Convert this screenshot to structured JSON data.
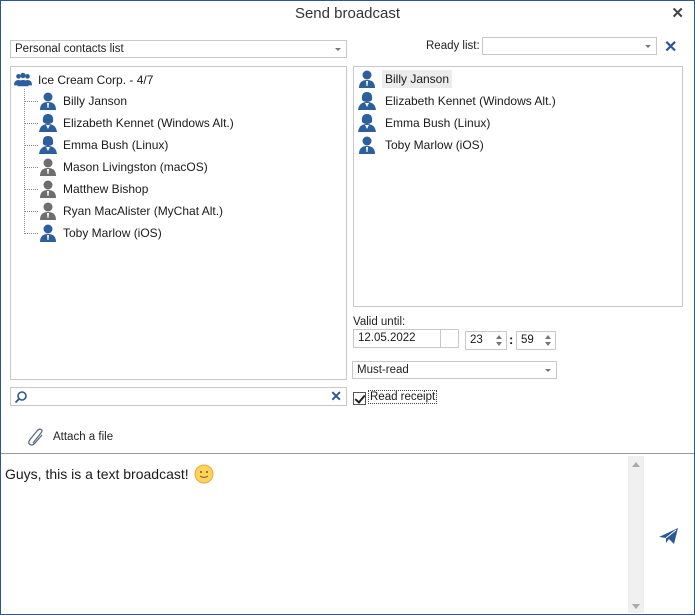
{
  "window": {
    "title": "Send broadcast",
    "close_icon": "close-icon"
  },
  "contacts": {
    "source_selected": "Personal contacts list",
    "group": {
      "label": "Ice Cream Corp. - 4/7",
      "icon": "group-icon",
      "members": [
        {
          "name": "Billy Janson",
          "gender": "male",
          "status": "online"
        },
        {
          "name": "Elizabeth Kennet (Windows Alt.)",
          "gender": "female",
          "status": "online"
        },
        {
          "name": "Emma Bush (Linux)",
          "gender": "female",
          "status": "online"
        },
        {
          "name": "Mason Livingston (macOS)",
          "gender": "male",
          "status": "offline"
        },
        {
          "name": "Matthew Bishop",
          "gender": "male",
          "status": "offline"
        },
        {
          "name": "Ryan MacAlister (MyChat Alt.)",
          "gender": "male",
          "status": "offline"
        },
        {
          "name": "Toby Marlow (iOS)",
          "gender": "male",
          "status": "online"
        }
      ]
    },
    "search": {
      "value": "",
      "placeholder": ""
    }
  },
  "ready_list": {
    "label": "Ready list:",
    "selected": "",
    "recipients": [
      {
        "name": "Billy Janson",
        "gender": "male",
        "selected": true
      },
      {
        "name": "Elizabeth Kennet (Windows Alt.)",
        "gender": "female",
        "selected": false
      },
      {
        "name": "Emma Bush (Linux)",
        "gender": "female",
        "selected": false
      },
      {
        "name": "Toby Marlow (iOS)",
        "gender": "male",
        "selected": false
      }
    ]
  },
  "options": {
    "valid_until_label": "Valid until:",
    "date": "12.05.2022",
    "hour": "23",
    "minute": "59",
    "time_separator": ":",
    "priority": "Must-read",
    "read_receipt_label": "Read receipt",
    "read_receipt_checked": true
  },
  "attach": {
    "label": "Attach a file"
  },
  "message": {
    "text": "Guys, this is a text broadcast!",
    "emoji": "smiley"
  },
  "colors": {
    "accent": "#2b5797",
    "icon_online": "#2d5f9e",
    "icon_offline": "#6e6e6e"
  }
}
